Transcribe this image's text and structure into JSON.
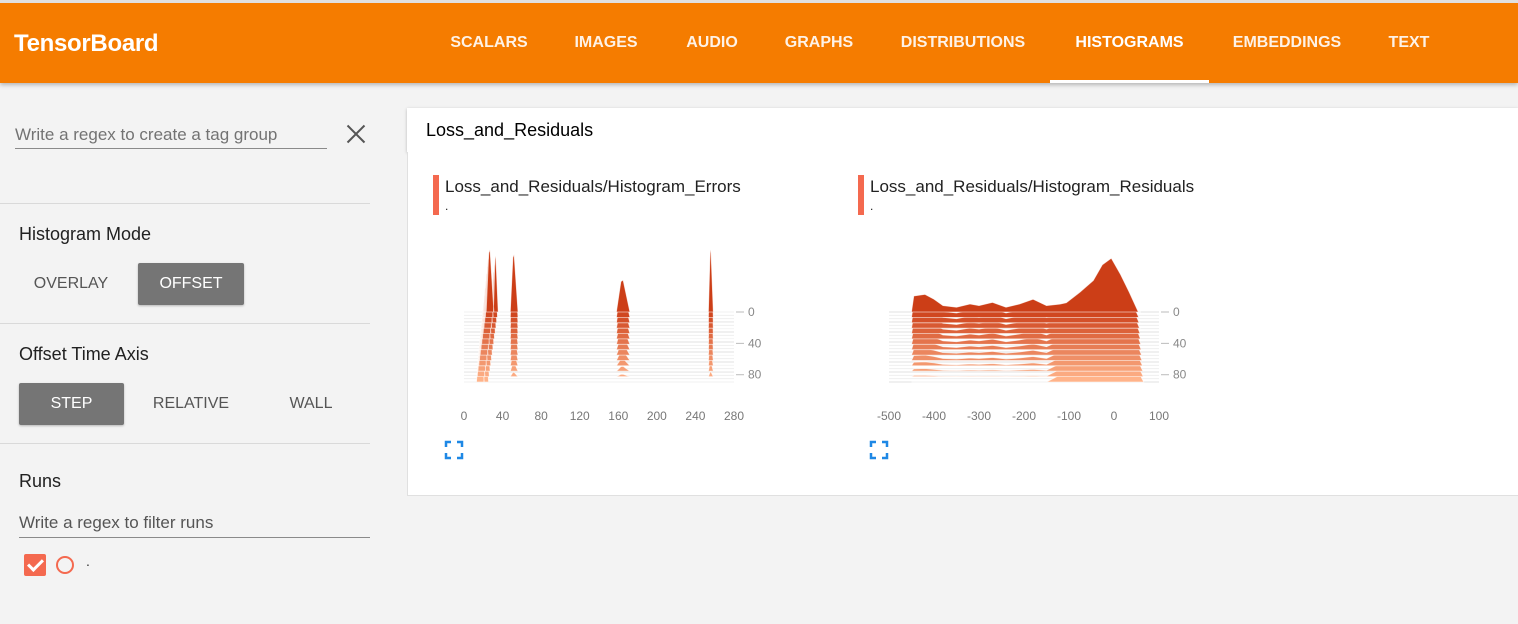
{
  "header": {
    "brand": "TensorBoard",
    "tabs": [
      {
        "label": "SCALARS"
      },
      {
        "label": "IMAGES"
      },
      {
        "label": "AUDIO"
      },
      {
        "label": "GRAPHS"
      },
      {
        "label": "DISTRIBUTIONS"
      },
      {
        "label": "HISTOGRAMS"
      },
      {
        "label": "EMBEDDINGS"
      },
      {
        "label": "TEXT"
      }
    ],
    "active_tab": "HISTOGRAMS",
    "accent_color": "#f57c00"
  },
  "sidebar": {
    "tag_group_placeholder": "Write a regex to create a tag group",
    "histogram_mode": {
      "title": "Histogram Mode",
      "options": [
        "OVERLAY",
        "OFFSET"
      ],
      "selected": "OFFSET"
    },
    "offset_time_axis": {
      "title": "Offset Time Axis",
      "options": [
        "STEP",
        "RELATIVE",
        "WALL"
      ],
      "selected": "STEP"
    },
    "runs": {
      "title": "Runs",
      "filter_placeholder": "Write a regex to filter runs",
      "items": [
        {
          "label": ".",
          "checked": true,
          "color": "#f4694f"
        }
      ]
    }
  },
  "main": {
    "group_title": "Loss_and_Residuals"
  },
  "chart_data": [
    {
      "type": "histogram-offset",
      "title": "Loss_and_Residuals/Histogram_Errors",
      "subtitle": ".",
      "x_ticks": [
        "0",
        "40",
        "80",
        "120",
        "160",
        "200",
        "240",
        "280"
      ],
      "xlim": [
        0,
        280
      ],
      "y_ticks": [
        "0",
        "40",
        "80"
      ],
      "ylim": [
        0,
        100
      ],
      "peaks_front": [
        {
          "center": 27,
          "width": 8,
          "height": 78
        },
        {
          "center": 33,
          "width": 5,
          "height": 70
        },
        {
          "center": 52,
          "width": 8,
          "height": 72
        },
        {
          "center": 165,
          "width": 14,
          "height": 40
        },
        {
          "center": 256,
          "width": 5,
          "height": 78
        }
      ],
      "colors": {
        "front": "#cc3e17",
        "back": "#ffb38a"
      }
    },
    {
      "type": "histogram-offset",
      "title": "Loss_and_Residuals/Histogram_Residuals",
      "subtitle": ".",
      "x_ticks": [
        "-500",
        "-400",
        "-300",
        "-200",
        "-100",
        "0",
        "100"
      ],
      "xlim": [
        -500,
        100
      ],
      "y_ticks": [
        "0",
        "40",
        "80"
      ],
      "ylim": [
        0,
        100
      ],
      "front_profile": [
        [
          -450,
          0
        ],
        [
          -445,
          20
        ],
        [
          -420,
          22
        ],
        [
          -400,
          16
        ],
        [
          -380,
          8
        ],
        [
          -350,
          6
        ],
        [
          -320,
          10
        ],
        [
          -300,
          8
        ],
        [
          -270,
          12
        ],
        [
          -240,
          6
        ],
        [
          -210,
          10
        ],
        [
          -180,
          16
        ],
        [
          -150,
          8
        ],
        [
          -120,
          12
        ],
        [
          -100,
          14
        ],
        [
          -70,
          30
        ],
        [
          -40,
          48
        ],
        [
          -20,
          72
        ],
        [
          0,
          82
        ],
        [
          20,
          58
        ],
        [
          40,
          30
        ],
        [
          60,
          0
        ]
      ],
      "colors": {
        "front": "#cc3e17",
        "back": "#ffb38a"
      }
    }
  ]
}
